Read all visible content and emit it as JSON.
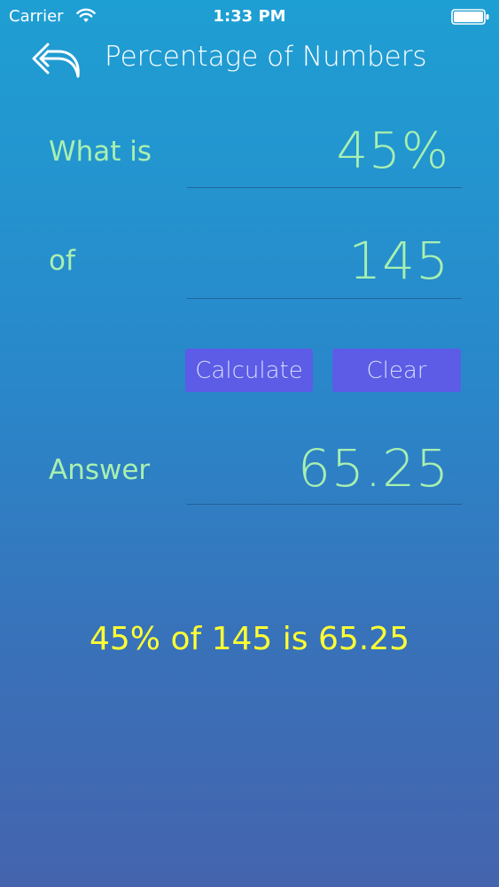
{
  "status_bar": {
    "carrier": "Carrier",
    "time": "1:33 PM",
    "wifi_icon": "wifi-icon",
    "battery_icon": "battery-icon"
  },
  "nav": {
    "back_icon": "reply-arrow-icon",
    "title": "Percentage of Numbers"
  },
  "form": {
    "percent_label": "What is",
    "percent_value": "45%",
    "number_label": "of",
    "number_value": "145",
    "answer_label": "Answer",
    "answer_value": "65.25"
  },
  "buttons": {
    "calculate_label": "Calculate",
    "clear_label": "Clear"
  },
  "summary": "45% of 145 is 65.25",
  "colors": {
    "background_top": "#1e9fd3",
    "background_bottom": "#4464ae",
    "label_green": "#a8f0b0",
    "button_purple": "#5c5ce6",
    "summary_yellow": "#ffff33"
  }
}
